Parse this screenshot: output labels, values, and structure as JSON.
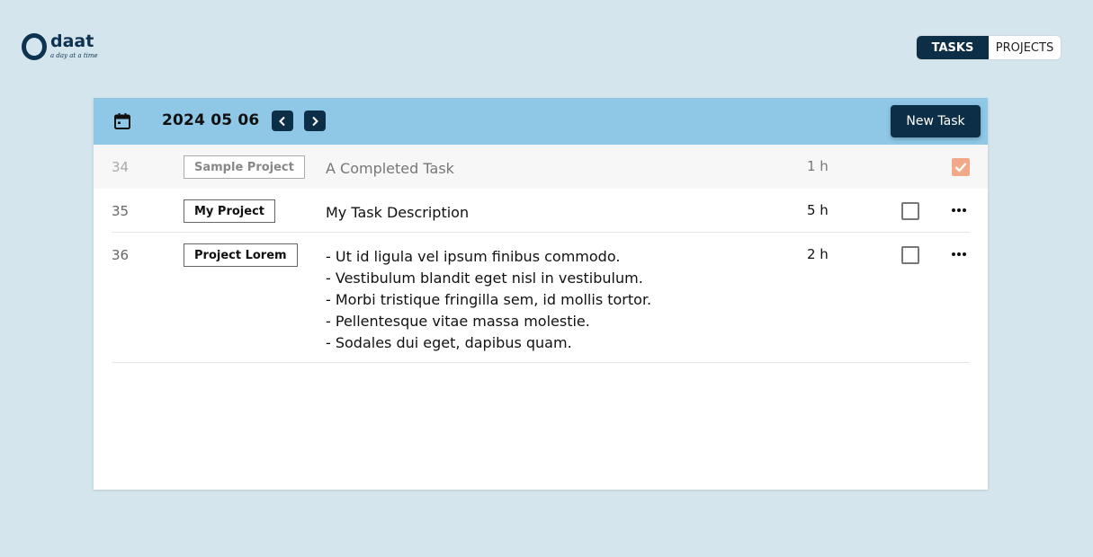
{
  "logo": {
    "word": "daat",
    "tagline": "a day at a time"
  },
  "nav": {
    "tasks_label": "TASKS",
    "projects_label": "PROJECTS"
  },
  "header": {
    "date": "2024 05 06",
    "new_task_label": "New Task"
  },
  "tasks": [
    {
      "id": "34",
      "project": "Sample Project",
      "description": [
        "A Completed Task"
      ],
      "hours": "1 h",
      "completed": true
    },
    {
      "id": "35",
      "project": "My Project",
      "description": [
        "My Task Description"
      ],
      "hours": "5 h",
      "completed": false
    },
    {
      "id": "36",
      "project": "Project Lorem",
      "description": [
        "- Ut id ligula vel ipsum finibus commodo.",
        "- Vestibulum blandit eget nisl in vestibulum.",
        "- Morbi tristique fringilla sem, id mollis tortor.",
        "- Pellentesque vitae massa molestie.",
        "- Sodales dui eget, dapibus quam."
      ],
      "hours": "2 h",
      "completed": false
    }
  ],
  "colors": {
    "background": "#d4e5ed",
    "header_bar": "#8ec8e6",
    "primary_dark": "#0c2f47",
    "completed_check": "#f4a88a"
  },
  "icons": {
    "calendar": "calendar-icon",
    "prev": "chevron-left-icon",
    "next": "chevron-right-icon",
    "more": "more-horizontal-icon",
    "check": "checkmark-icon"
  }
}
